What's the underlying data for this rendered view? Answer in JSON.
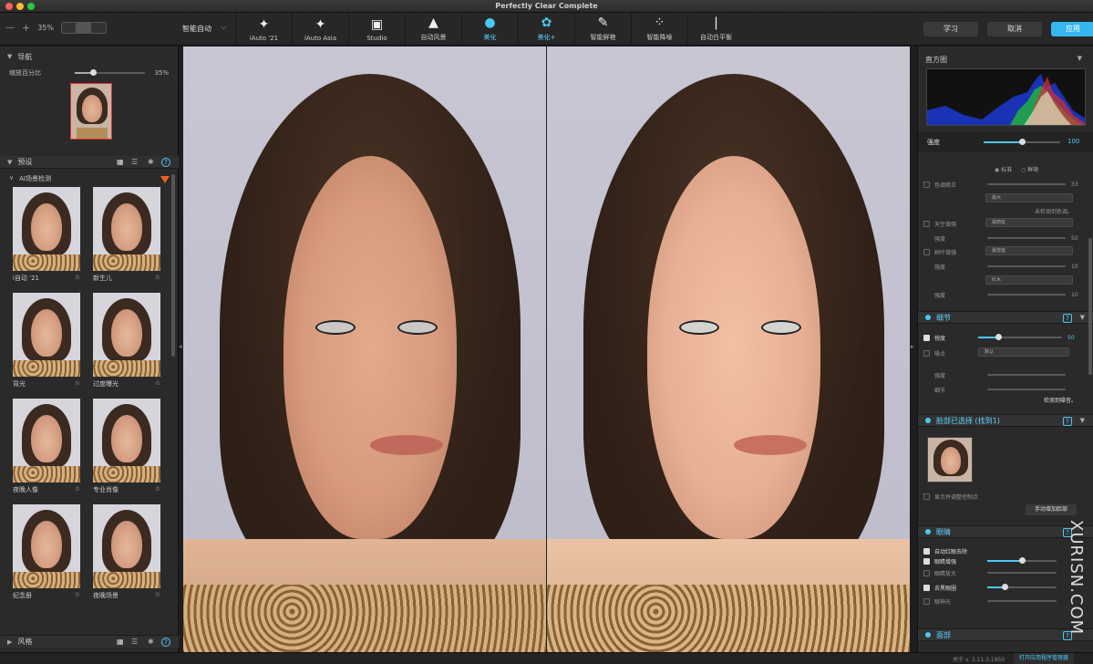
{
  "window": {
    "title": "Perfectly Clear Complete"
  },
  "toolbar": {
    "zoom_minus": "—",
    "zoom_plus": "+",
    "zoom_value": "35%",
    "preset_select": "智能自动",
    "tools": [
      {
        "label": "iAuto '21",
        "icon": "wand-icon",
        "glyph": "✦"
      },
      {
        "label": "iAuto Asia",
        "icon": "wand-icon",
        "glyph": "✦"
      },
      {
        "label": "Studio",
        "icon": "portrait-icon",
        "glyph": "▣"
      },
      {
        "label": "自动风景",
        "icon": "landscape-icon",
        "glyph": "▲"
      },
      {
        "label": "美化",
        "icon": "beautify-icon",
        "glyph": "●",
        "active": true
      },
      {
        "label": "美化+",
        "icon": "beautify-plus-icon",
        "glyph": "✿",
        "active": true
      },
      {
        "label": "智能鲜艳",
        "icon": "brush-icon",
        "glyph": "✎"
      },
      {
        "label": "智能降噪",
        "icon": "noise-icon",
        "glyph": "⁘"
      },
      {
        "label": "自动白平衡",
        "icon": "thermometer-icon",
        "glyph": "❘"
      }
    ],
    "buttons": {
      "learn": "学习",
      "cancel": "取消",
      "apply": "应用"
    }
  },
  "left_panel": {
    "nav_title": "导航",
    "zoom_label": "缩放百分比",
    "zoom_value": "35%",
    "zoom_fraction": 0.25,
    "presets_title": "预设",
    "ai_scene": "AI场景检测",
    "presets": [
      {
        "label": "i自动 '21"
      },
      {
        "label": "新生儿"
      },
      {
        "label": "背光"
      },
      {
        "label": "过度曝光"
      },
      {
        "label": "夜晚人像"
      },
      {
        "label": "专业肖像"
      },
      {
        "label": "纪念册"
      },
      {
        "label": "夜晚场景"
      }
    ],
    "styles_title": "风格",
    "star": "☆"
  },
  "right_panel": {
    "histogram_title": "直方图",
    "strength_label": "强度",
    "strength_value": "100",
    "strength_fraction": 0.5,
    "radio_standard": "标准",
    "radio_vivid": "鲜艳",
    "color_fix": "色调修正",
    "color_fix_value": "33",
    "color_mode": "最大",
    "no_cast": "未检测到色调。",
    "sky": "天空增强",
    "sky_mode": "最蔚蓝",
    "sky_strength": "强度",
    "sky_value": "50",
    "foliage": "树叶增强",
    "foliage_mode": "最茂盛",
    "foliage_strength": "强度",
    "foliage_value": "10",
    "foliage_color": "红木",
    "foliage_strength2": "强度",
    "foliage_value2": "10",
    "detail_title": "细节",
    "sharpen": "锐度",
    "sharpen_value": "50",
    "sharpen_fraction": 0.24,
    "noise": "噪点",
    "noise_mode": "默认",
    "noise_strength": "强度",
    "noise_detail": "细节",
    "no_noise": "检测到噪音。",
    "face_title": "脸部已选择 (找到1)",
    "show_face": "显示并调整控制点",
    "add_face": "手动增加脸部",
    "eyes_title": "眼睛",
    "eye_items": [
      {
        "label": "自动红眼去除",
        "checked": true
      },
      {
        "label": "眼睛增强",
        "checked": true
      },
      {
        "label": "眼睛放大",
        "checked": false
      },
      {
        "label": "去黑眼圈",
        "checked": true
      },
      {
        "label": "眼神光",
        "checked": false
      }
    ],
    "face_section": "面部"
  },
  "status": {
    "version": "关于 v. 3.11.3.1950",
    "open_manager": "打开应用程序管理器"
  },
  "watermark": "XURISN.COM"
}
